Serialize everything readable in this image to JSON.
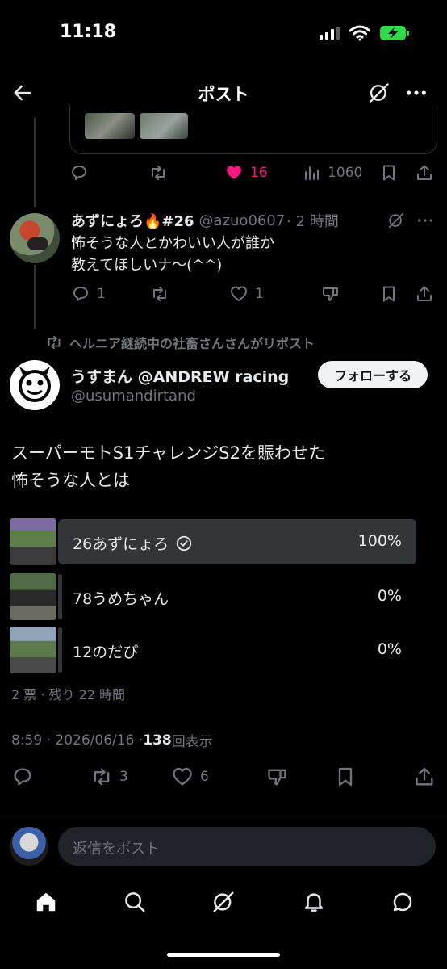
{
  "status": {
    "time": "11:18"
  },
  "header": {
    "title": "ポスト",
    "back_icon": "back-arrow-icon",
    "grok_icon": "grok-icon",
    "more_icon": "more-icon"
  },
  "prev_post_actions": {
    "likes": "16",
    "views": "1060"
  },
  "reply": {
    "name": "あずにょろ🔥#26",
    "handle": "@azuo0607",
    "time": "· 2 時間",
    "text_line1": "怖そうな人とかわいい人が誰か",
    "text_line2": "教えてほしいナ〜(^^)",
    "replies": "1",
    "likes": "1"
  },
  "repost_banner": "ヘルニア継続中の社畜さんさんがリポスト",
  "main_post": {
    "name": "うすまん @ANDREW racing",
    "handle": "@usumandirtand",
    "follow_label": "フォローする",
    "text_line1": "スーパーモトS1チャレンジS2を賑わせた",
    "text_line2": "怖そうな人とは",
    "poll": [
      {
        "label": "26あずにょろ",
        "percent": "100%",
        "fraction": 1.0,
        "checked": true
      },
      {
        "label": "78うめちゃん",
        "percent": "0%",
        "fraction": 0.0,
        "checked": false
      },
      {
        "label": "12のだぴ",
        "percent": "0%",
        "fraction": 0.0,
        "checked": false
      }
    ],
    "poll_meta": "2 票 · 残り 22 時間",
    "timestamp": "8:59 · 2026/06/16 · ",
    "views_count": "138",
    "views_label": " 回表示",
    "retweets": "3",
    "likes": "6"
  },
  "reply_box": {
    "placeholder": "返信をポスト"
  },
  "colors": {
    "accent_like": "#f91880",
    "bg": "#000000",
    "muted": "#71767b",
    "text": "#e7e9ea"
  }
}
